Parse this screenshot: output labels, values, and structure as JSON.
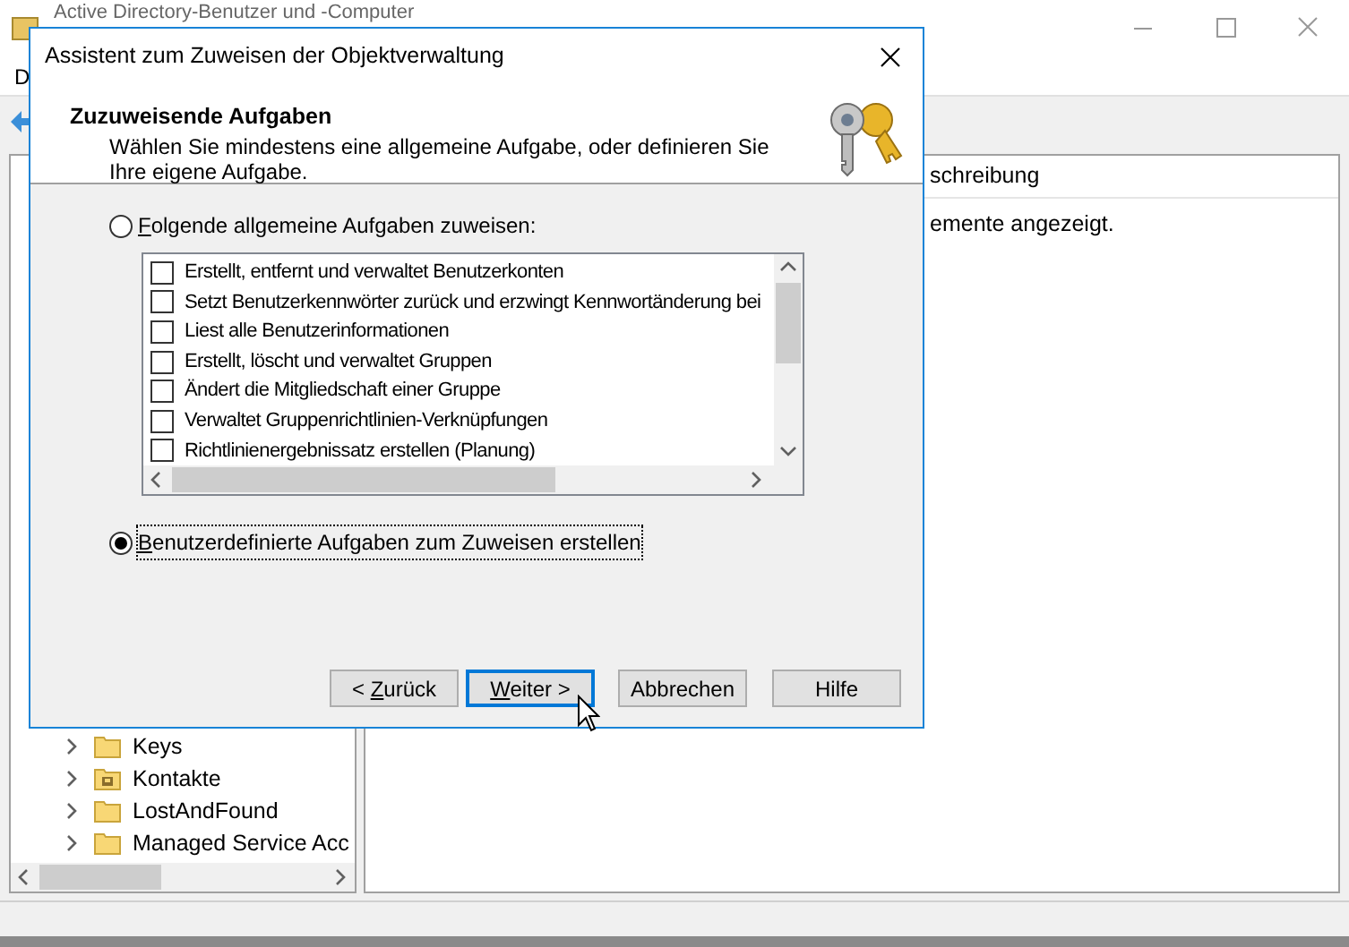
{
  "main_window": {
    "title": "Active Directory-Benutzer und -Computer",
    "menu": [
      "D"
    ],
    "tree": [
      {
        "label": "Keys",
        "kind": "folder"
      },
      {
        "label": "Kontakte",
        "kind": "contacts"
      },
      {
        "label": "LostAndFound",
        "kind": "folder"
      },
      {
        "label": "Managed Service Acc",
        "kind": "folder"
      }
    ],
    "list_header": "schreibung",
    "empty_message": "emente angezeigt."
  },
  "dialog": {
    "title": "Assistent zum Zuweisen der Objektverwaltung",
    "heading": "Zuzuweisende Aufgaben",
    "description": "Wählen Sie mindestens eine allgemeine Aufgabe, oder definieren Sie Ihre eigene Aufgabe.",
    "options": [
      {
        "access_key": "F",
        "after": "olgende allgemeine Aufgaben zuweisen:",
        "selected": false
      },
      {
        "access_key": "B",
        "after": "enutzerdefinierte Aufgaben zum Zuweisen erstellen",
        "selected": true
      }
    ],
    "tasks": [
      {
        "label": "Erstellt, entfernt und verwaltet Benutzerkonten",
        "checked": false
      },
      {
        "label": "Setzt Benutzerkennwörter zurück und erzwingt Kennwortänderung bei",
        "checked": false
      },
      {
        "label": "Liest alle Benutzerinformationen",
        "checked": false
      },
      {
        "label": "Erstellt, löscht und verwaltet Gruppen",
        "checked": false
      },
      {
        "label": "Ändert die Mitgliedschaft einer Gruppe",
        "checked": false
      },
      {
        "label": "Verwaltet Gruppenrichtlinien-Verknüpfungen",
        "checked": false
      },
      {
        "label": "Richtlinienergebnissatz erstellen (Planung)",
        "checked": false
      }
    ],
    "buttons": [
      {
        "before": "< ",
        "access_key": "Z",
        "after": "urück",
        "default": false
      },
      {
        "access_key": "W",
        "after": "eiter >",
        "default": true
      },
      {
        "before": "Abbrechen",
        "default": false
      },
      {
        "before": "Hilfe",
        "default": false
      }
    ]
  }
}
